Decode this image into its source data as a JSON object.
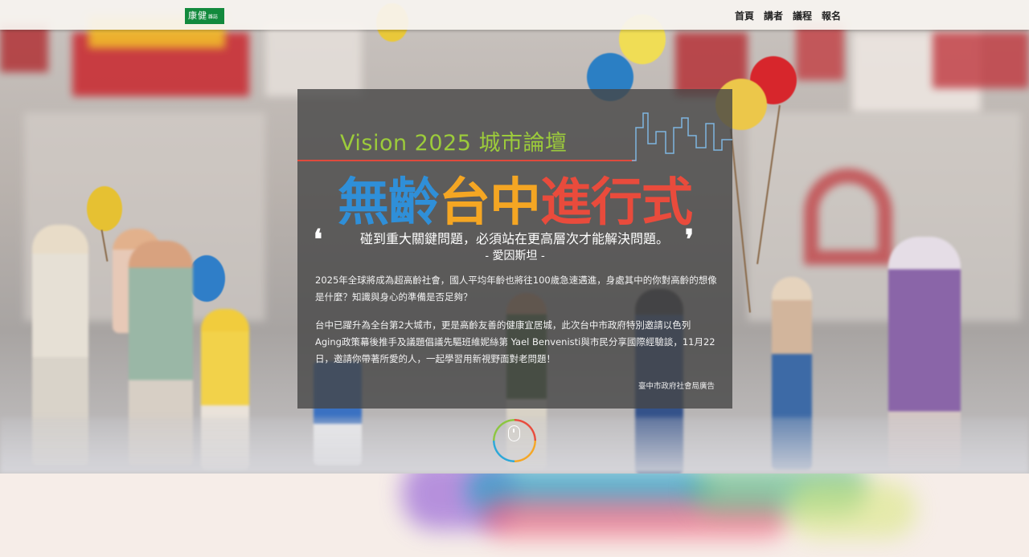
{
  "nav": {
    "logo_text": "康健",
    "logo_sub": "雜誌",
    "items": [
      {
        "label": "首頁"
      },
      {
        "label": "講者"
      },
      {
        "label": "議程"
      },
      {
        "label": "報名"
      }
    ]
  },
  "hero": {
    "vision_title": "Vision 2025 城市論壇",
    "main_title": {
      "parts": [
        {
          "text": "無齡",
          "color": "#2f8fd8"
        },
        {
          "text": "台",
          "color": "#f5a623"
        },
        {
          "text": "中",
          "color": "#f5a623"
        },
        {
          "text": "進行式",
          "color": "#e94b3c"
        }
      ]
    },
    "quote": "碰到重大關鍵問題，必須站在更高層次才能解決問題。",
    "quote_open": "❛",
    "quote_close": "❜",
    "quote_author": "- 愛因斯坦 -",
    "paragraph_1": "2025年全球將成為超高齡社會，國人平均年齡也將往100歲急速邁進，身處其中的你對高齡的想像是什麼？知識與身心的準備是否足夠？",
    "paragraph_2": "台中已躍升為全台第2大城市，更是高齡友善的健康宜居城，此次台中市政府特別邀請以色列Aging政策幕後推手及議題倡議先驅班維妮絲第 Yael Benvenisti與市民分享國際經驗談，11月22日，邀請你帶著所愛的人，一起學習用新視野面對老問題！",
    "credit": "臺中市政府社會局廣告"
  },
  "colors": {
    "accent_green": "#9ccb3b",
    "accent_red": "#e94b3c",
    "accent_blue": "#2f8fd8",
    "accent_orange": "#f5a623",
    "brand_green": "#138a3d"
  },
  "icons": {
    "scroll": "mouse-icon"
  }
}
